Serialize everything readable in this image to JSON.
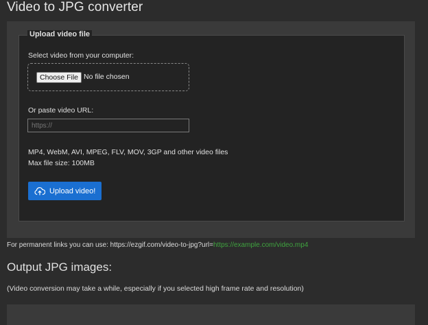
{
  "page": {
    "title": "Video to JPG converter"
  },
  "upload": {
    "legend": "Upload video file",
    "select_label": "Select video from your computer:",
    "choose_button": "Choose File",
    "no_file_text": "No file chosen",
    "url_label": "Or paste video URL:",
    "url_placeholder": "https://",
    "formats_text": "MP4, WebM, AVI, MPEG, FLV, MOV, 3GP and other video files",
    "max_size_text": "Max file size: 100MB",
    "upload_button": "Upload video!"
  },
  "permalink": {
    "prefix": "For permanent links you can use: https://ezgif.com/video-to-jpg?url=",
    "example_url": "https://example.com/video.mp4"
  },
  "output": {
    "title": "Output JPG images:",
    "note": "(Video conversion may take a while, especially if you selected high frame rate and resolution)"
  },
  "colors": {
    "background": "#2c2c2c",
    "panel": "#3a3a3a",
    "fieldset": "#232323",
    "upload_button": "#1a6fd1",
    "link": "#3fa33f"
  }
}
